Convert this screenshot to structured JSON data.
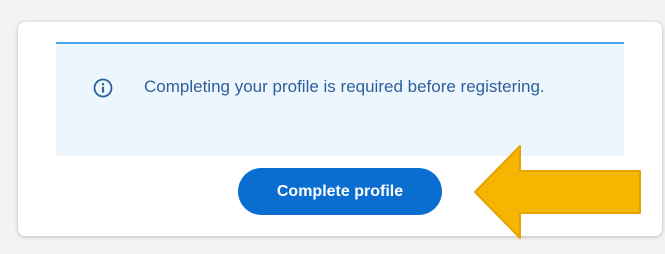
{
  "notice": {
    "icon": "info-icon",
    "message": "Completing your profile is required before registering."
  },
  "actions": {
    "complete_profile_label": "Complete profile"
  },
  "annotation": {
    "icon": "arrow-left-icon",
    "color": "#f7b500"
  },
  "colors": {
    "primary": "#0a6ed1",
    "notice_bg": "#eef6fd",
    "notice_border": "#4ba3e6",
    "notice_text": "#2d5f9c"
  }
}
